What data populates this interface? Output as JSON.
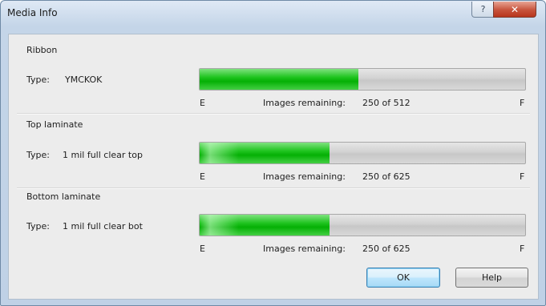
{
  "window": {
    "title": "Media Info",
    "help_glyph": "?",
    "close_glyph": "✕"
  },
  "sections": [
    {
      "title": "Ribbon",
      "type_label": "Type:",
      "type_value": "YMCKOK",
      "empty_label": "E",
      "full_label": "F",
      "remaining_label": "Images remaining:",
      "remaining_value": "250 of 512",
      "level": 0.488
    },
    {
      "title": "Top laminate",
      "type_label": "Type:",
      "type_value": "1 mil full clear top",
      "empty_label": "E",
      "full_label": "F",
      "remaining_label": "Images remaining:",
      "remaining_value": "250 of 625",
      "level": 0.4
    },
    {
      "title": "Bottom laminate",
      "type_label": "Type:",
      "type_value": "1 mil full clear bot",
      "empty_label": "E",
      "full_label": "F",
      "remaining_label": "Images remaining:",
      "remaining_value": "250 of 625",
      "level": 0.4
    }
  ],
  "buttons": {
    "ok_label": "OK",
    "help_label": "Help"
  },
  "colors": {
    "fill_green": "#05b005",
    "bar_bg": "#cfcfcf",
    "close_red": "#c7533c",
    "dialog_bg": "#ececec"
  }
}
